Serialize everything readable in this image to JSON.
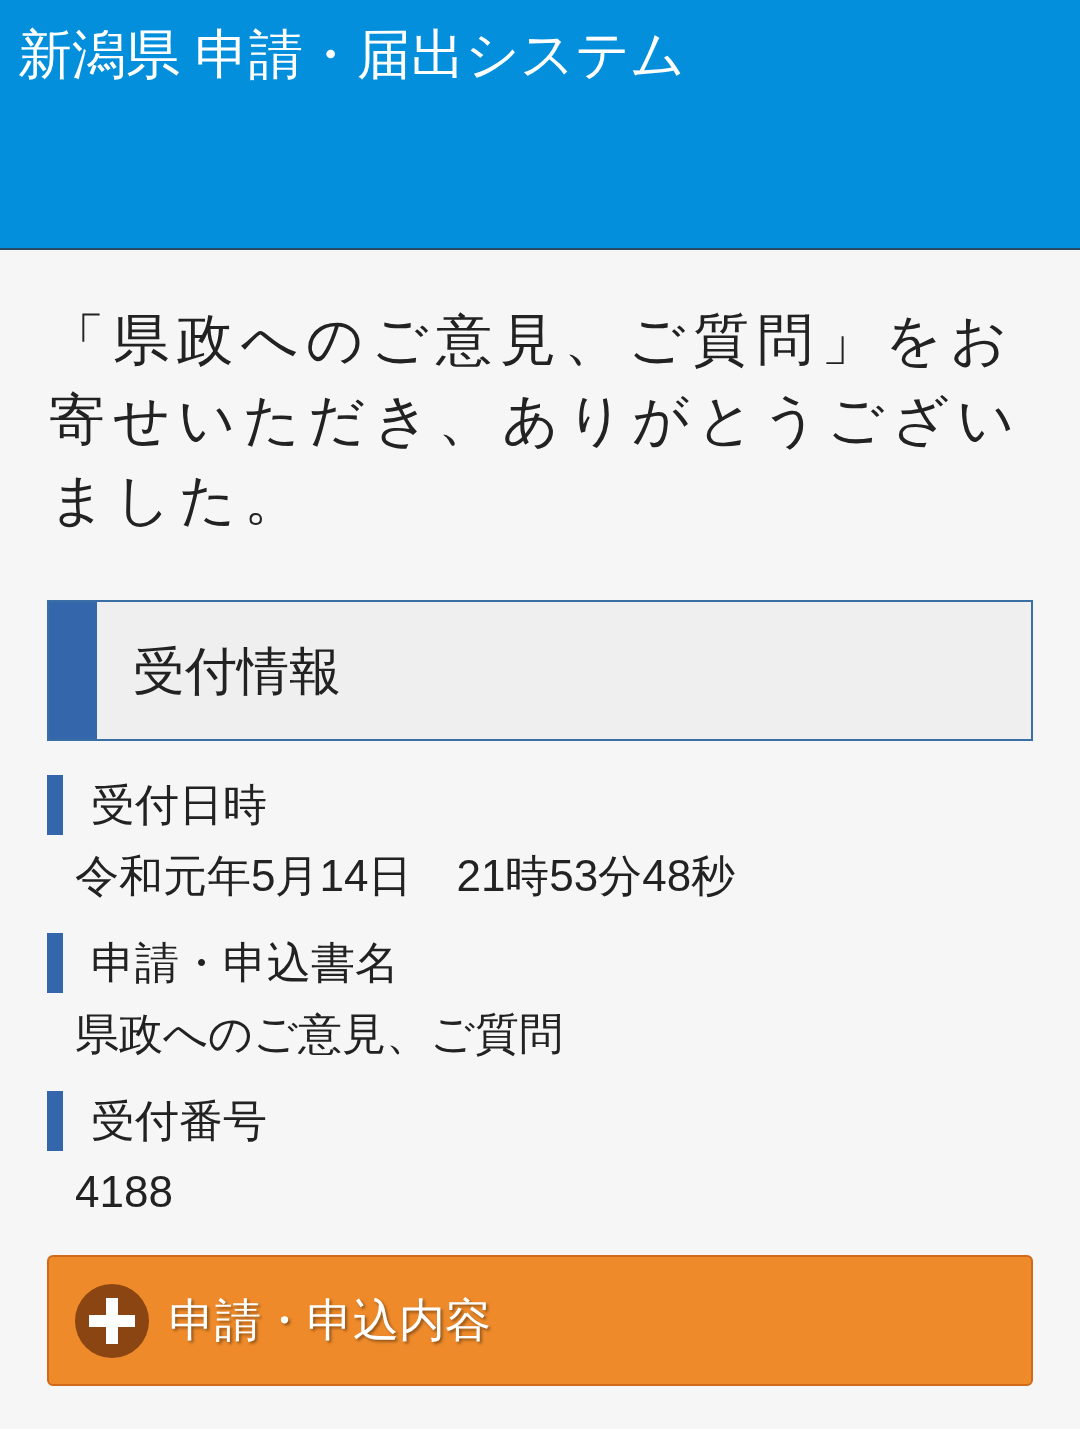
{
  "header": {
    "title": "新潟県 申請・届出システム"
  },
  "message": "「県政へのご意見、ご質問」をお寄せいただき、ありがとうございました。",
  "section": {
    "title": "受付情報"
  },
  "fields": [
    {
      "label": "受付日時",
      "value": "令和元年5月14日　21時53分48秒"
    },
    {
      "label": "申請・申込書名",
      "value": "県政へのご意見、ご質問"
    },
    {
      "label": "受付番号",
      "value": "4188"
    }
  ],
  "expand_button": {
    "label": "申請・申込内容",
    "expanded": false
  }
}
